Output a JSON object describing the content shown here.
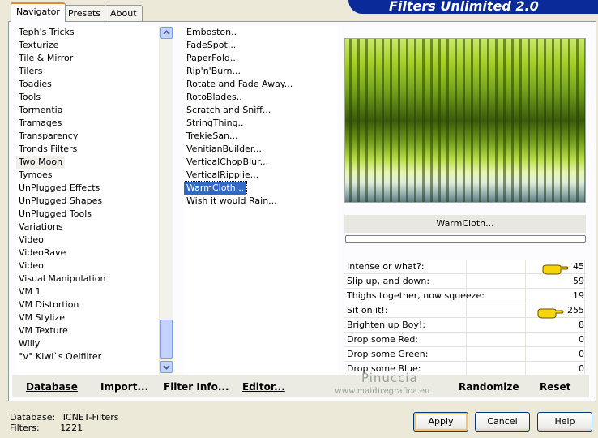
{
  "banner_title": "Filters Unlimited 2.0",
  "tabs": [
    {
      "label": "Navigator",
      "active": true
    },
    {
      "label": "Presets",
      "active": false
    },
    {
      "label": "About",
      "active": false
    }
  ],
  "categories": {
    "items": [
      "Teph's Tricks",
      "Texturize",
      "Tile & Mirror",
      "Tilers",
      "Toadies",
      "Tools",
      "Tormentia",
      "Tramages",
      "Transparency",
      "Tronds Filters",
      "Two Moon",
      "Tymoes",
      "UnPlugged Effects",
      "UnPlugged Shapes",
      "UnPlugged Tools",
      "Variations",
      "Video",
      "VideoRave",
      "Video",
      "Visual Manipulation",
      "VM 1",
      "VM Distortion",
      "VM Stylize",
      "VM Texture",
      "Willy",
      "°v° Kiwi`s Oelfilter"
    ],
    "selected": "Two Moon"
  },
  "filters": {
    "items": [
      "Emboston..",
      "FadeSpot...",
      "PaperFold...",
      "Rip'n'Burn...",
      "Rotate and Fade Away...",
      "RotoBlades..",
      "Scratch and Sniff...",
      "StringThing..",
      "TrekieSan...",
      "VenitianBuilder...",
      "VerticalChopBlur...",
      "VerticalRipplie...",
      "WarmCloth...",
      "Wish it would Rain..."
    ],
    "selected": "WarmCloth..."
  },
  "preview": {
    "filter_name": "WarmCloth...",
    "colors": {
      "light_green": "#c8e86a",
      "dark_green": "#3a5a0a",
      "gray": "#5e7a7c"
    }
  },
  "parameters": [
    {
      "label": "Intense or what?:",
      "value": "45",
      "pointer": true
    },
    {
      "label": "Slip up, and down:",
      "value": "59",
      "pointer": false
    },
    {
      "label": "Thighs together, now squeeze:",
      "value": "19",
      "pointer": false
    },
    {
      "label": "Sit on it!:",
      "value": "255",
      "pointer": true
    },
    {
      "label": "Brighten up Boy!:",
      "value": "8",
      "pointer": false
    },
    {
      "label": "Drop some Red:",
      "value": "0",
      "pointer": false
    },
    {
      "label": "Drop some Green:",
      "value": "0",
      "pointer": false
    },
    {
      "label": "Drop some Blue:",
      "value": "0",
      "pointer": false
    }
  ],
  "toolbar": {
    "database": "Database",
    "import": "Import...",
    "filter_info": "Filter Info...",
    "editor": "Editor...",
    "randomize": "Randomize",
    "reset": "Reset"
  },
  "watermark": {
    "name": "Pinuccia",
    "site": "www.maidiregrafica.eu"
  },
  "status": {
    "database_label": "Database:",
    "database_value": "ICNET-Filters",
    "filters_label": "Filters:",
    "filters_value": "1221"
  },
  "buttons": {
    "apply": "Apply",
    "cancel": "Cancel",
    "help": "Help"
  }
}
